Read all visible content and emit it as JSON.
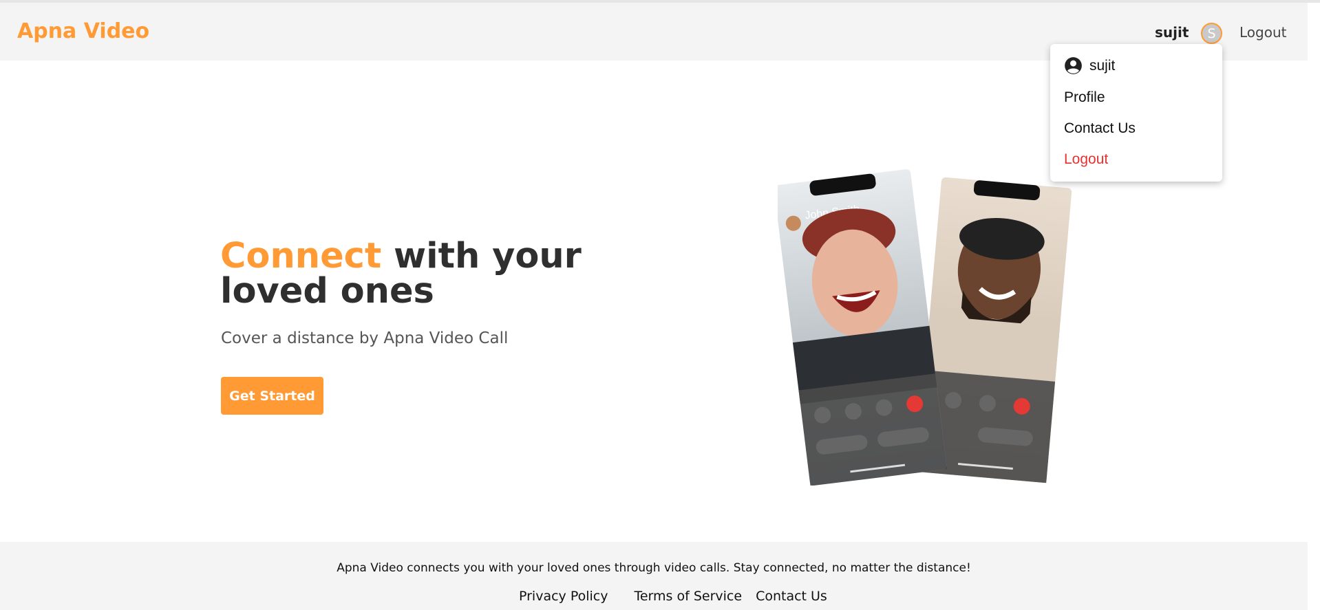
{
  "app": {
    "brand": "Apna Video",
    "accent_color": "#ff9a35"
  },
  "nav": {
    "username": "sujit",
    "avatar_letter": "S",
    "logout_label": "Logout"
  },
  "dropdown": {
    "user_label": "sujit",
    "profile_label": "Profile",
    "contact_label": "Contact Us",
    "logout_label": "Logout",
    "logout_color": "#e53131"
  },
  "hero": {
    "title_accent": "Connect",
    "title_rest": " with your loved ones",
    "subtitle": "Cover a distance by Apna Video Call",
    "cta_label": "Get Started",
    "phone1_caller": "John Smith"
  },
  "footer": {
    "text": "Apna Video connects you with your loved ones through video calls. Stay connected, no matter the distance!",
    "links": [
      "Privacy Policy",
      "Terms of Service",
      "Contact Us"
    ]
  }
}
